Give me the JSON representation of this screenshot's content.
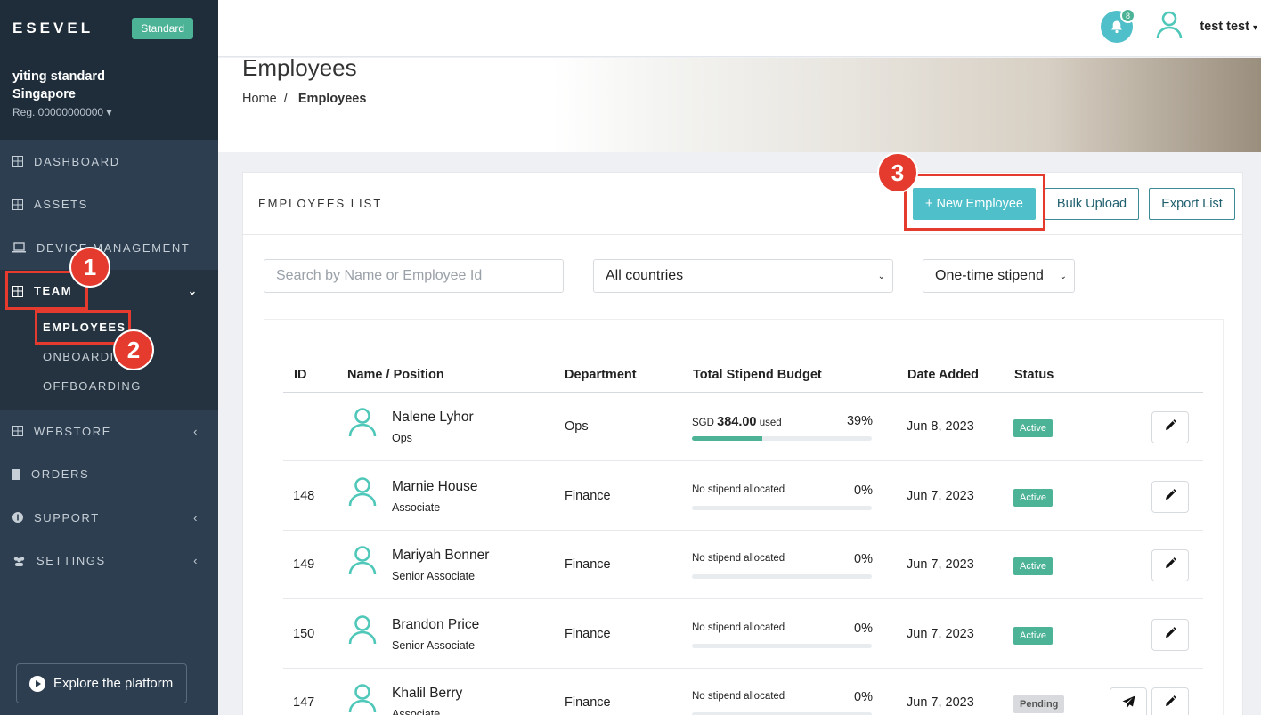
{
  "brand": "ESEVEL",
  "plan": "Standard",
  "org": {
    "name_line1": "yiting standard",
    "name_line2": "Singapore",
    "reg": "Reg. 00000000000"
  },
  "nav": {
    "dashboard": "DASHBOARD",
    "assets": "ASSETS",
    "device_management": "DEVICE MANAGEMENT",
    "team": "TEAM",
    "team_sub": [
      "EMPLOYEES",
      "ONBOARDING",
      "OFFBOARDING"
    ],
    "webstore": "WEBSTORE",
    "orders": "ORDERS",
    "support": "SUPPORT",
    "settings": "SETTINGS"
  },
  "explore": "Explore the platform",
  "header": {
    "notification_count": "8",
    "user_name": "test test"
  },
  "page": {
    "title": "Employees",
    "breadcrumb_home": "Home",
    "breadcrumb_sep": "/",
    "breadcrumb_current": "Employees"
  },
  "card": {
    "title": "EMPLOYEES LIST",
    "new_button": "+ New Employee",
    "bulk_button": "Bulk Upload",
    "export_button": "Export List"
  },
  "filters": {
    "search_placeholder": "Search by Name or Employee Id",
    "country": "All countries",
    "stipend": "One-time stipend"
  },
  "table": {
    "headers": [
      "ID",
      "Name / Position",
      "Department",
      "Total Stipend Budget",
      "Date Added",
      "Status"
    ],
    "rows": [
      {
        "id": "",
        "name": "Nalene Lyhor",
        "position": "Ops",
        "department": "Ops",
        "currency": "SGD",
        "amount": "384.00",
        "used": "used",
        "stipend": "",
        "pct": "39%",
        "progress": 0.39,
        "date": "Jun 8, 2023",
        "status": "Active"
      },
      {
        "id": "148",
        "name": "Marnie House",
        "position": "Associate",
        "department": "Finance",
        "stipend": "No stipend allocated",
        "pct": "0%",
        "progress": 0,
        "date": "Jun 7, 2023",
        "status": "Active"
      },
      {
        "id": "149",
        "name": "Mariyah Bonner",
        "position": "Senior Associate",
        "department": "Finance",
        "stipend": "No stipend allocated",
        "pct": "0%",
        "progress": 0,
        "date": "Jun 7, 2023",
        "status": "Active"
      },
      {
        "id": "150",
        "name": "Brandon Price",
        "position": "Senior Associate",
        "department": "Finance",
        "stipend": "No stipend allocated",
        "pct": "0%",
        "progress": 0,
        "date": "Jun 7, 2023",
        "status": "Active"
      },
      {
        "id": "147",
        "name": "Khalil Berry",
        "position": "Associate",
        "department": "Finance",
        "stipend": "No stipend allocated",
        "pct": "0%",
        "progress": 0,
        "date": "Jun 7, 2023",
        "status": "Pending"
      }
    ]
  },
  "annotations": [
    "1",
    "2",
    "3"
  ],
  "colors": {
    "accent": "#4fbfc9",
    "success": "#4db396",
    "sidebar": "#2c3e50",
    "highlight": "#e53b2f"
  }
}
